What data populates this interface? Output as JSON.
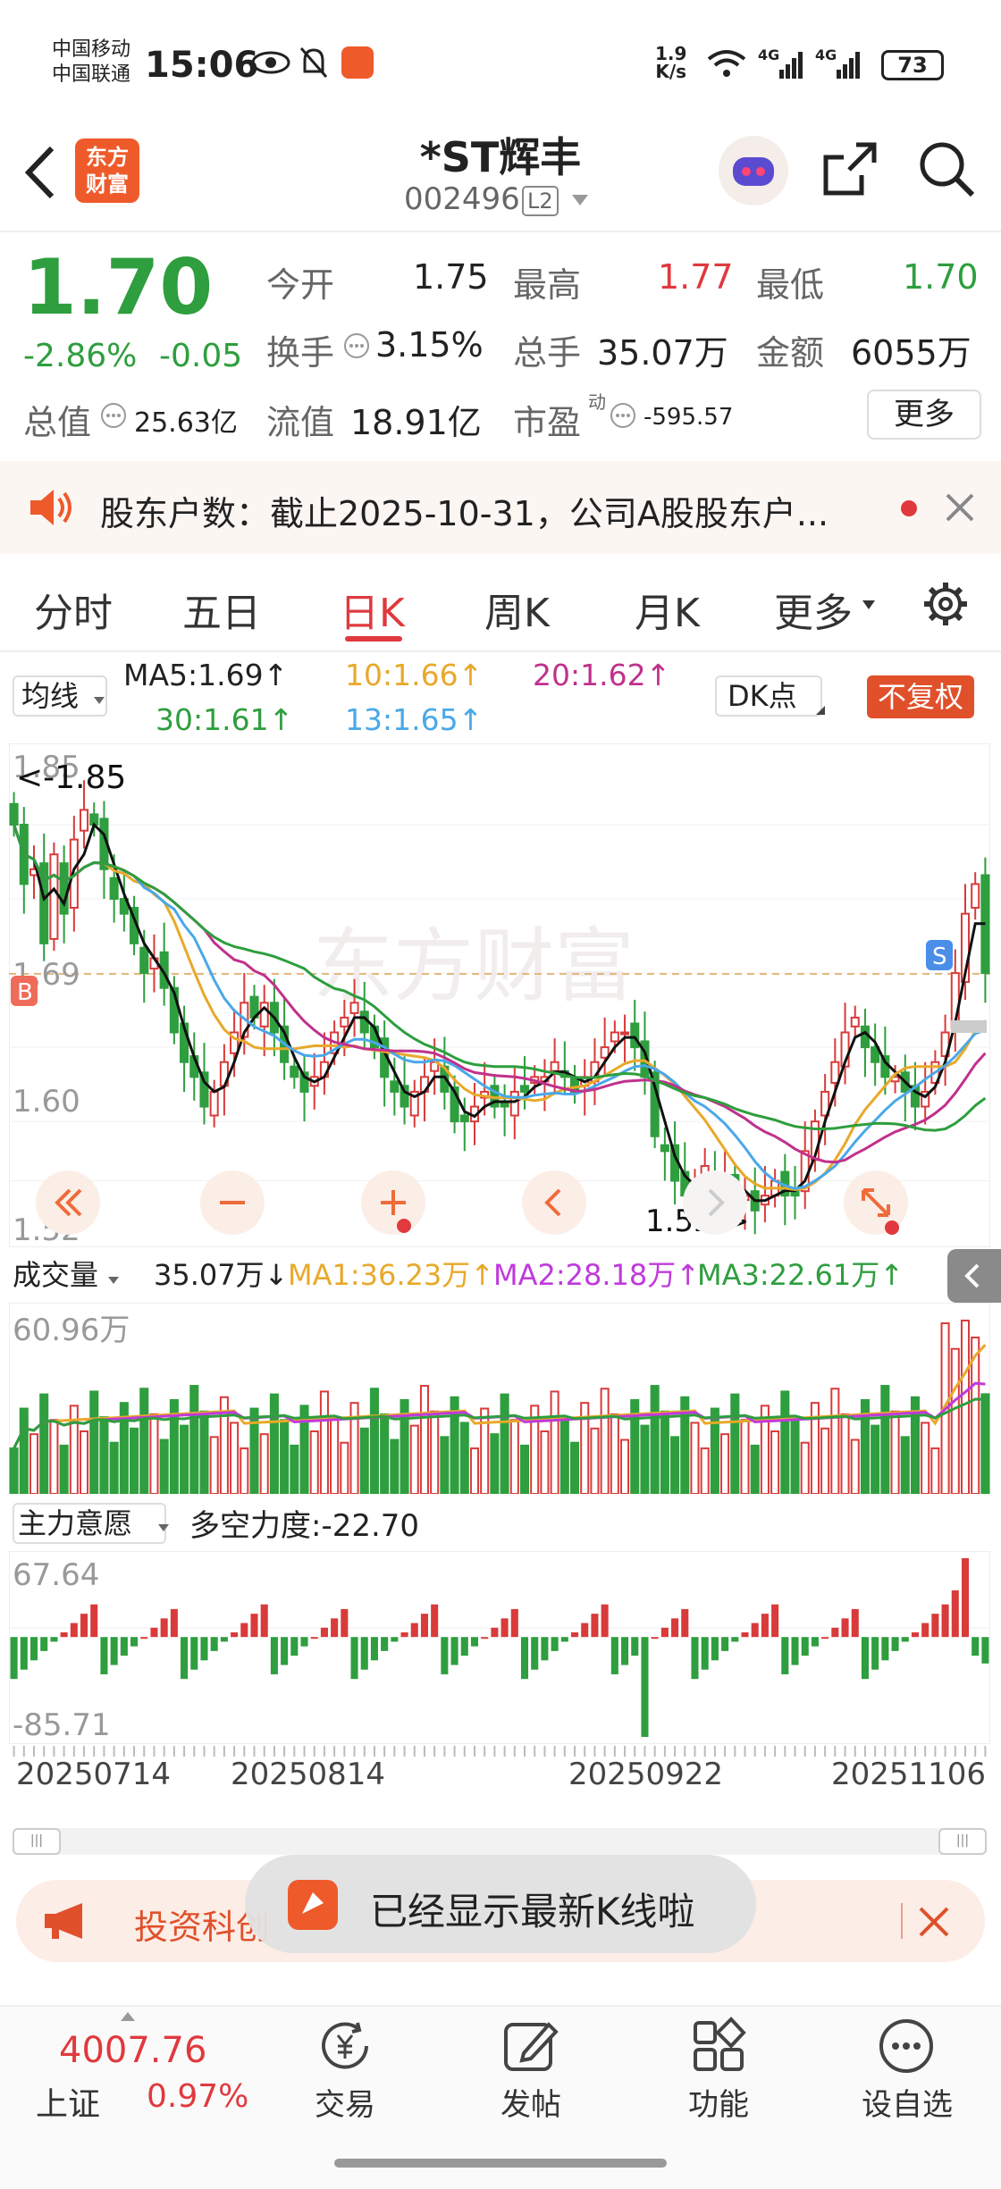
{
  "status_bar": {
    "carrier1": "中国移动",
    "carrier2": "中国联通",
    "time": "15:06",
    "net_speed_top": "1.9",
    "net_speed_unit": "K/s",
    "sig1": "4G",
    "sig2": "4G",
    "battery": "73"
  },
  "header": {
    "logo_line1": "东方",
    "logo_line2": "财富",
    "stock_name": "*ST辉丰",
    "stock_code": "002496",
    "level": "L2"
  },
  "quote": {
    "price": "1.70",
    "change_pct": "-2.86%",
    "change": "-0.05",
    "open_label": "今开",
    "open": "1.75",
    "high_label": "最高",
    "high": "1.77",
    "low_label": "最低",
    "low": "1.70",
    "turnover_label": "换手",
    "turnover": "3.15%",
    "volume_label": "总手",
    "volume": "35.07万",
    "amount_label": "金额",
    "amount": "6055万",
    "mktcap_label": "总值",
    "mktcap": "25.63亿",
    "float_label": "流值",
    "float": "18.91亿",
    "pe_label": "市盈",
    "pe_sup": "动",
    "pe": "-595.57",
    "more": "更多"
  },
  "notice": {
    "text": "股东户数：截止2025-10-31，公司A股股东户..."
  },
  "tabs": [
    "分时",
    "五日",
    "日K",
    "周K",
    "月K",
    "更多"
  ],
  "ma_row": {
    "selector": "均线",
    "ma5": "MA5:1.69",
    "ma10": "10:1.66",
    "ma20": "20:1.62",
    "ma30": "30:1.61",
    "ma13": "13:1.65",
    "dk": "DK点",
    "fq": "不复权"
  },
  "kline": {
    "top_price": "1.85",
    "max_tag": "<-1.85",
    "mid_price": "1.69",
    "low_grid": "1.60",
    "bottom_price": "1.52",
    "min_tag": "1.52->",
    "b_tag": "B",
    "s_tag": "S",
    "watermark": "东方财富"
  },
  "volume": {
    "selector": "成交量",
    "value": "35.07万",
    "ma1": "MA1:36.23万",
    "ma2": "MA2:28.18万",
    "ma3": "MA3:22.61万",
    "max": "60.96万"
  },
  "force": {
    "selector": "主力意愿",
    "label": "多空力度:-22.70",
    "max": "67.64",
    "min": "-85.71"
  },
  "dates": [
    "20250714",
    "20250814",
    "20250922",
    "20251106"
  ],
  "promo": {
    "text": "投资科创"
  },
  "toast": {
    "text": "已经显示最新K线啦"
  },
  "bottom": {
    "index_value": "4007.76",
    "index_name": "上证",
    "index_pct": "0.97%",
    "trade": "交易",
    "post": "发帖",
    "func": "功能",
    "watch": "设自选"
  },
  "chart_data": {
    "type": "candlestick",
    "price_range": [
      1.52,
      1.85
    ],
    "last_close": 1.7,
    "closes": [
      1.8,
      1.76,
      1.77,
      1.72,
      1.78,
      1.74,
      1.79,
      1.81,
      1.8,
      1.77,
      1.75,
      1.74,
      1.72,
      1.7,
      1.71,
      1.69,
      1.66,
      1.64,
      1.63,
      1.61,
      1.62,
      1.64,
      1.66,
      1.68,
      1.67,
      1.68,
      1.66,
      1.64,
      1.63,
      1.62,
      1.63,
      1.64,
      1.66,
      1.67,
      1.68,
      1.66,
      1.65,
      1.63,
      1.62,
      1.61,
      1.62,
      1.63,
      1.64,
      1.62,
      1.6,
      1.6,
      1.61,
      1.62,
      1.61,
      1.61,
      1.62,
      1.62,
      1.63,
      1.63,
      1.64,
      1.63,
      1.62,
      1.63,
      1.64,
      1.65,
      1.66,
      1.66,
      1.65,
      1.63,
      1.59,
      1.58,
      1.56,
      1.55,
      1.56,
      1.57,
      1.56,
      1.56,
      1.55,
      1.55,
      1.54,
      1.55,
      1.56,
      1.55,
      1.55,
      1.58,
      1.6,
      1.62,
      1.64,
      1.66,
      1.67,
      1.65,
      1.64,
      1.63,
      1.63,
      1.62,
      1.61,
      1.62,
      1.64,
      1.66,
      1.7,
      1.74,
      1.76,
      1.7
    ],
    "volume_max": 60.96,
    "force_range": [
      -85.71,
      67.64
    ]
  }
}
